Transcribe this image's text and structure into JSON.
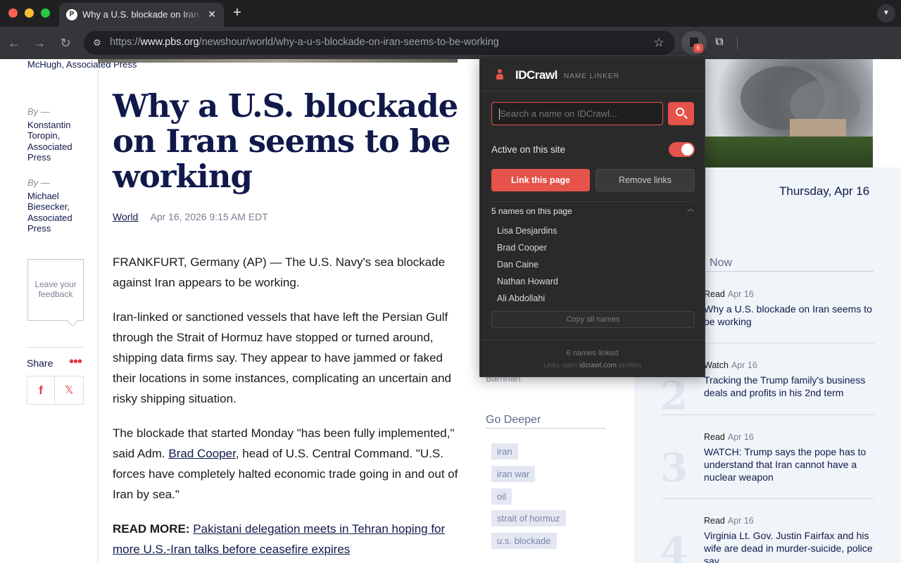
{
  "browser": {
    "tab_title": "Why a U.S. blockade on Iran seems to be working",
    "url_prefix": "https://",
    "url_host": "www.pbs.org",
    "url_path": "/newshour/world/why-a-u-s-blockade-on-iran-seems-to-be-working",
    "extension_badge": "6"
  },
  "article": {
    "bylines": [
      {
        "by": "",
        "name": "McHugh, Associated Press"
      },
      {
        "by": "By —",
        "name": "Konstantin Toropin, Associated Press"
      },
      {
        "by": "By —",
        "name": "Michael Biesecker, Associated Press"
      }
    ],
    "feedback_label": "Leave your feedback",
    "share_label": "Share",
    "headline": "Why a U.S. blockade on Iran seems to be working",
    "section": "World",
    "date": "Apr 16, 2026 9:15 AM EDT",
    "p1": "FRANKFURT, Germany (AP) — The U.S. Navy's sea blockade against Iran appears to be working.",
    "p2": "Iran-linked or sanctioned vessels that have left the Persian Gulf through the Strait of Hormuz have stopped or turned around, shipping data firms say. They appear to have jammed or faked their locations in some instances, complicating an uncertain and risky shipping situation.",
    "p3_a": "The blockade that started Monday \"has been fully implemented,\" said Adm. ",
    "p3_link": "Brad Cooper",
    "p3_b": ", head of U.S. Central Command. \"U.S. forces have completely halted economic trade going in and out of Iran by sea.\"",
    "readmore_label": "READ MORE:",
    "readmore_link": "Pakistani delegation meets in Tehran hoping for more U.S.-Iran talks before ceasefire expires"
  },
  "sidebar": {
    "date": "Thursday, Apr 16",
    "now_label": "Now",
    "barnhart": "Barnhart",
    "go_deeper": "Go Deeper",
    "tags": [
      "iran",
      "iran war",
      "oil",
      "strait of hormuz",
      "u.s. blockade"
    ],
    "items": [
      {
        "num": "",
        "kind": "Read",
        "date": "Apr 16",
        "title": "Why a U.S. blockade on Iran seems to be working"
      },
      {
        "num": "2",
        "kind": "Watch",
        "date": "Apr 16",
        "title": "Tracking the Trump family's business deals and profits in his 2nd term"
      },
      {
        "num": "3",
        "kind": "Read",
        "date": "Apr 16",
        "title": "WATCH: Trump says the pope has to understand that Iran cannot have a nuclear weapon"
      },
      {
        "num": "4",
        "kind": "Read",
        "date": "Apr 16",
        "title": "Virginia Lt. Gov. Justin Fairfax and his wife are dead in murder-suicide, police say"
      }
    ]
  },
  "popup": {
    "brand": "IDCrawl",
    "subtitle": "NAME LINKER",
    "search_placeholder": "Search a name on IDCrawl...",
    "active_label": "Active on this site",
    "link_button": "Link this page",
    "remove_button": "Remove links",
    "names_header": "5 names on this page",
    "names": [
      "Lisa Desjardins",
      "Brad Cooper",
      "Dan Caine",
      "Nathan Howard",
      "Ali Abdollahi"
    ],
    "copy_button": "Copy all names",
    "linked_count": "6 names linked",
    "footer_a": "Links open ",
    "footer_site": "idcrawl.com",
    "footer_b": " profiles",
    "accent": "#e5534b"
  }
}
